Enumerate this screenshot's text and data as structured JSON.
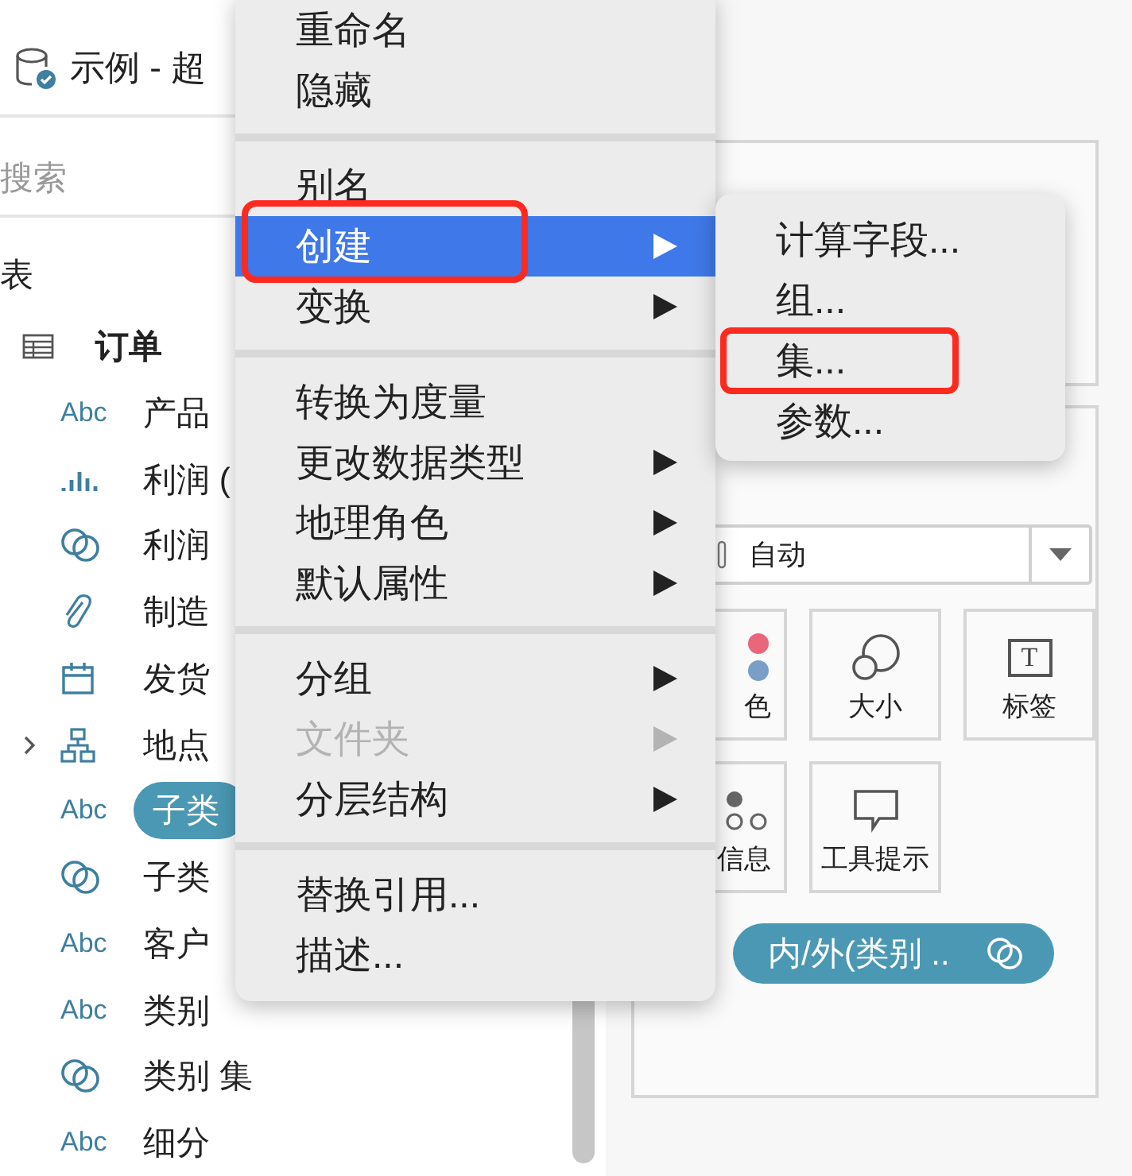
{
  "source": {
    "title": "示例 - 超"
  },
  "search": {
    "placeholder": "搜索"
  },
  "tables_heading": "表",
  "table": {
    "label": "订单"
  },
  "fields": [
    {
      "kind": "text",
      "type_label": "Abc",
      "label": "产品",
      "selected": false
    },
    {
      "kind": "measure",
      "label": "利润 (",
      "selected": false
    },
    {
      "kind": "set",
      "label": "利润",
      "selected": false
    },
    {
      "kind": "group",
      "label": "制造",
      "selected": false
    },
    {
      "kind": "date",
      "label": "发货",
      "selected": false
    },
    {
      "kind": "hierarchy",
      "label": "地点",
      "expanded": false,
      "selected": false
    },
    {
      "kind": "text",
      "type_label": "Abc",
      "label": "子类",
      "selected": true
    },
    {
      "kind": "set",
      "label": "子类",
      "selected": false
    },
    {
      "kind": "text",
      "type_label": "Abc",
      "label": "客户",
      "selected": false
    },
    {
      "kind": "text",
      "type_label": "Abc",
      "label": "类别",
      "selected": false
    },
    {
      "kind": "set",
      "label": "类别 集",
      "selected": false
    },
    {
      "kind": "text",
      "type_label": "Abc",
      "label": "细分",
      "selected": false
    }
  ],
  "marks": {
    "mark_type": "自动",
    "tiles": [
      {
        "kind": "color",
        "label": "色"
      },
      {
        "kind": "size",
        "label": "大小"
      },
      {
        "kind": "label",
        "glyph": "T",
        "label": "标签"
      },
      {
        "kind": "detail",
        "label": "信息"
      },
      {
        "kind": "tooltip",
        "label": "工具提示"
      }
    ],
    "pill": {
      "label": "内/外(类别 .."
    }
  },
  "context_menu": {
    "sections": [
      [
        {
          "label": "重命名",
          "submenu": false,
          "disabled": false,
          "selected": false,
          "highlighted": false
        },
        {
          "label": "隐藏",
          "submenu": false,
          "disabled": false,
          "selected": false,
          "highlighted": false
        }
      ],
      [
        {
          "label": "别名",
          "submenu": false,
          "disabled": false,
          "selected": false,
          "highlighted": false
        },
        {
          "label": "创建",
          "submenu": true,
          "disabled": false,
          "selected": true,
          "highlighted": true
        },
        {
          "label": "变换",
          "submenu": true,
          "disabled": false,
          "selected": false,
          "highlighted": false
        }
      ],
      [
        {
          "label": "转换为度量",
          "submenu": false,
          "disabled": false,
          "selected": false,
          "highlighted": false
        },
        {
          "label": "更改数据类型",
          "submenu": true,
          "disabled": false,
          "selected": false,
          "highlighted": false
        },
        {
          "label": "地理角色",
          "submenu": true,
          "disabled": false,
          "selected": false,
          "highlighted": false
        },
        {
          "label": "默认属性",
          "submenu": true,
          "disabled": false,
          "selected": false,
          "highlighted": false
        }
      ],
      [
        {
          "label": "分组",
          "submenu": true,
          "disabled": false,
          "selected": false,
          "highlighted": false
        },
        {
          "label": "文件夹",
          "submenu": true,
          "disabled": true,
          "selected": false,
          "highlighted": false
        },
        {
          "label": "分层结构",
          "submenu": true,
          "disabled": false,
          "selected": false,
          "highlighted": false
        }
      ],
      [
        {
          "label": "替换引用...",
          "submenu": false,
          "disabled": false,
          "selected": false,
          "highlighted": false
        },
        {
          "label": "描述...",
          "submenu": false,
          "disabled": false,
          "selected": false,
          "highlighted": false
        }
      ]
    ]
  },
  "submenu": {
    "items": [
      {
        "label": "计算字段...",
        "highlighted": false
      },
      {
        "label": "组...",
        "highlighted": false
      },
      {
        "label": "集...",
        "highlighted": true
      },
      {
        "label": "参数...",
        "highlighted": false
      }
    ]
  }
}
